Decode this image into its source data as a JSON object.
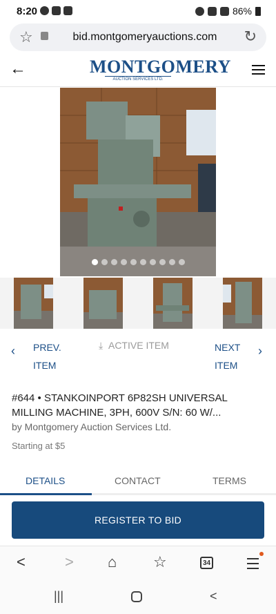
{
  "status_bar": {
    "time": "8:20",
    "battery": "86%"
  },
  "browser": {
    "url": "bid.montgomeryauctions.com",
    "tabs_count": "34"
  },
  "site": {
    "logo_main": "MONTGOMERY",
    "logo_sub": "AUCTION SERVICES LTD."
  },
  "gallery": {
    "image_count": 10,
    "active_index": 0,
    "thumbnail_count": 4
  },
  "item_nav": {
    "prev_line1": "PREV.",
    "prev_line2": "ITEM",
    "active_label": "ACTIVE ITEM",
    "next_line1": "NEXT",
    "next_line2": "ITEM"
  },
  "lot": {
    "title": "#644 • STANKOINPORT 6P82SH UNIVERSAL MILLING MACHINE, 3PH, 600V S/N: 60 W/...",
    "seller": "by Montgomery Auction Services Ltd.",
    "starting": "Starting at $5"
  },
  "tabs": [
    {
      "label": "DETAILS",
      "active": true
    },
    {
      "label": "CONTACT",
      "active": false
    },
    {
      "label": "TERMS",
      "active": false
    }
  ],
  "register_button": "REGISTER TO BID",
  "colors": {
    "brand": "#1c4f87",
    "button": "#174a7c",
    "notification": "#e05a1e"
  },
  "icons": [
    "back-arrow-icon",
    "menu-icon",
    "star-icon",
    "share-icon",
    "chevron-left-icon",
    "chevron-right-icon",
    "download-icon",
    "home-icon",
    "bookmark-star-icon",
    "reload-icon",
    "lock-icon"
  ]
}
